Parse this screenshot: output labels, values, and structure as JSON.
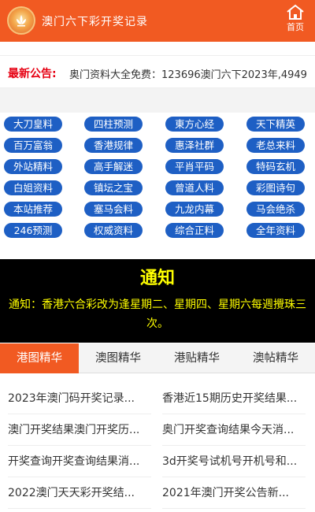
{
  "header": {
    "title": "澳门六下彩开奖记录",
    "home_label": "首页",
    "colors": {
      "brand": "#f15a22"
    },
    "logo_icon": "lotus-emblem-icon",
    "home_icon": "home-icon"
  },
  "notice": {
    "label": "最新公告:",
    "text": "奥门资料大全免费：123696澳门六下2023年,4949"
  },
  "links": [
    "大刀皇料",
    "四柱预测",
    "東方心经",
    "天下精英",
    "百万富翁",
    "香港规律",
    "惠泽社群",
    "老总来料",
    "外站精料",
    "高手解迷",
    "平肖平码",
    "特码玄机",
    "白姐资料",
    "镇坛之宝",
    "曾道人料",
    "彩图诗句",
    "本站推荐",
    "塞马会料",
    "九龙内幕",
    "马会绝杀",
    "246预测",
    "权威资料",
    "综合正料",
    "全年资料"
  ],
  "announcement": {
    "title": "通知",
    "text": "通知：香港六合彩改为逢星期二、星期四、星期六每週攪珠三次。"
  },
  "tabs": [
    "港图精华",
    "澳图精华",
    "港贴精华",
    "澳帖精华"
  ],
  "active_tab": 0,
  "articles": [
    "2023年澳门码开奖记录...",
    "香港近15期历史开奖结果...",
    "澳门开奖结果澳门开奖历...",
    "奥门开奖查询结果今天消...",
    "开奖查询开奖查询结果消...",
    "3d开奖号试机号开机号和...",
    "2022澳门天天彩开奖结...",
    "2021年澳门开奖公告新..."
  ],
  "colors": {
    "pill": "#1e5fc4",
    "announce_text": "#ffff00",
    "notice_label": "#e60012"
  }
}
